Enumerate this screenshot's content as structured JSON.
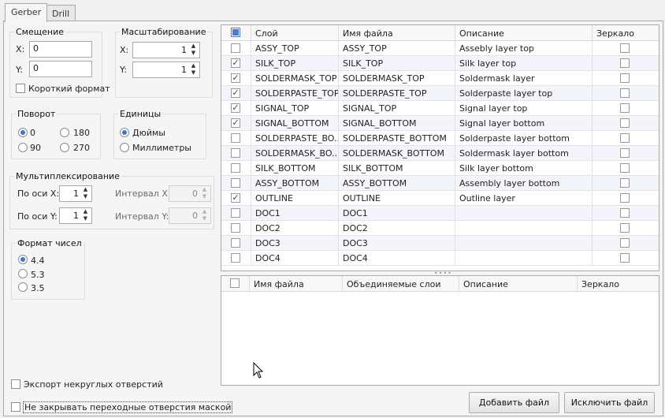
{
  "tabs": [
    {
      "label": "Gerber",
      "active": true
    },
    {
      "label": "Drill",
      "active": false
    }
  ],
  "offset": {
    "title": "Смещение",
    "x_label": "X:",
    "x_value": "0",
    "y_label": "Y:",
    "y_value": "0",
    "short_format_label": "Короткий формат",
    "short_format_checked": false
  },
  "scale": {
    "title": "Масштабирование",
    "x_label": "X:",
    "x_value": "1",
    "y_label": "Y:",
    "y_value": "1"
  },
  "rotation": {
    "title": "Поворот",
    "options": [
      "0",
      "180",
      "90",
      "270"
    ],
    "selected": "0"
  },
  "units": {
    "title": "Единицы",
    "options": [
      "Дюймы",
      "Миллиметры"
    ],
    "selected": "Дюймы"
  },
  "multiplex": {
    "title": "Мультиплексирование",
    "x_axis_label": "По оси X:",
    "x_axis_value": "1",
    "y_axis_label": "По оси Y:",
    "y_axis_value": "1",
    "x_interval_label": "Интервал X:",
    "x_interval_value": "0",
    "y_interval_label": "Интервал Y:",
    "y_interval_value": "0"
  },
  "number_format": {
    "title": "Формат чисел",
    "options": [
      "4.4",
      "5.3",
      "3.5"
    ],
    "selected": "4.4"
  },
  "export_nonround_label": "Экспорт некруглых отверстий",
  "no_tent_vias_label": "Не закрывать переходные отверстия маской",
  "layers_table": {
    "columns": [
      "Слой",
      "Имя файла",
      "Описание",
      "Зеркало"
    ],
    "rows": [
      {
        "layer": "ASSY_TOP",
        "file": "ASSY_TOP",
        "desc": "Assebly layer top",
        "checked": false
      },
      {
        "layer": "SILK_TOP",
        "file": "SILK_TOP",
        "desc": "Silk layer top",
        "checked": true
      },
      {
        "layer": "SOLDERMASK_TOP",
        "file": "SOLDERMASK_TOP",
        "desc": "Soldermask layer",
        "checked": true
      },
      {
        "layer": "SOLDERPASTE_TOP",
        "file": "SOLDERPASTE_TOP",
        "desc": "Solderpaste layer top",
        "checked": true
      },
      {
        "layer": "SIGNAL_TOP",
        "file": "SIGNAL_TOP",
        "desc": "Signal layer top",
        "checked": true
      },
      {
        "layer": "SIGNAL_BOTTOM",
        "file": "SIGNAL_BOTTOM",
        "desc": "Signal layer bottom",
        "checked": true
      },
      {
        "layer": "SOLDERPASTE_BO...",
        "file": "SOLDERPASTE_BOTTOM",
        "desc": "Solderpaste layer bottom",
        "checked": false
      },
      {
        "layer": "SOLDERMASK_BO...",
        "file": "SOLDERMASK_BOTTOM",
        "desc": "Soldermask layer bottom",
        "checked": false
      },
      {
        "layer": "SILK_BOTTOM",
        "file": "SILK_BOTTOM",
        "desc": "Silk layer bottom",
        "checked": false
      },
      {
        "layer": "ASSY_BOTTOM",
        "file": "ASSY_BOTTOM",
        "desc": "Assembly layer bottom",
        "checked": false
      },
      {
        "layer": "OUTLINE",
        "file": "OUTLINE",
        "desc": "Outline layer",
        "checked": true
      },
      {
        "layer": "DOC1",
        "file": "DOC1",
        "desc": "",
        "checked": false
      },
      {
        "layer": "DOC2",
        "file": "DOC2",
        "desc": "",
        "checked": false
      },
      {
        "layer": "DOC3",
        "file": "DOC3",
        "desc": "",
        "checked": false
      },
      {
        "layer": "DOC4",
        "file": "DOC4",
        "desc": "",
        "checked": false
      }
    ]
  },
  "files_table": {
    "columns": [
      "Имя файла",
      "Объединяемые слои",
      "Описание",
      "Зеркало"
    ]
  },
  "buttons": {
    "add_file": "Добавить файл",
    "remove_file": "Исключить файл"
  },
  "icons": {
    "check": "✓",
    "arrow_up": "▲",
    "arrow_down": "▼",
    "cursor": "mouse-pointer-icon"
  }
}
